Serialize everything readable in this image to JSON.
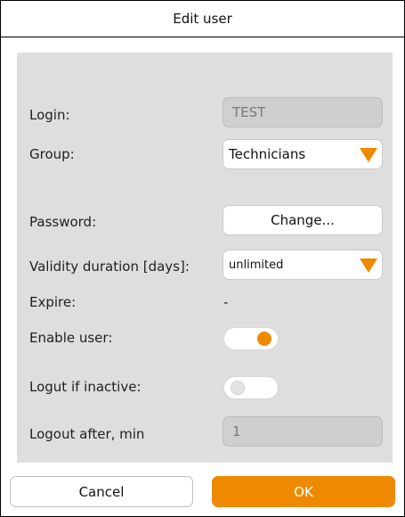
{
  "window": {
    "title": "Edit user"
  },
  "colors": {
    "accent": "#ef8a00",
    "panel_bg": "#dedede"
  },
  "form": {
    "login": {
      "label": "Login:",
      "value": "TEST",
      "disabled": true
    },
    "group": {
      "label": "Group:",
      "value": "Technicians"
    },
    "password": {
      "label": "Password:",
      "button_label": "Change..."
    },
    "validity": {
      "label": "Validity duration [days]:",
      "value": "unlimited"
    },
    "expire": {
      "label": "Expire:",
      "value": "-"
    },
    "enable_user": {
      "label": "Enable user:",
      "state": "on"
    },
    "logout_inactive": {
      "label": "Logut if inactive:",
      "state": "off"
    },
    "logout_after": {
      "label": "Logout after, min",
      "value": "1",
      "disabled": true
    }
  },
  "footer": {
    "cancel_label": "Cancel",
    "ok_label": "OK"
  }
}
